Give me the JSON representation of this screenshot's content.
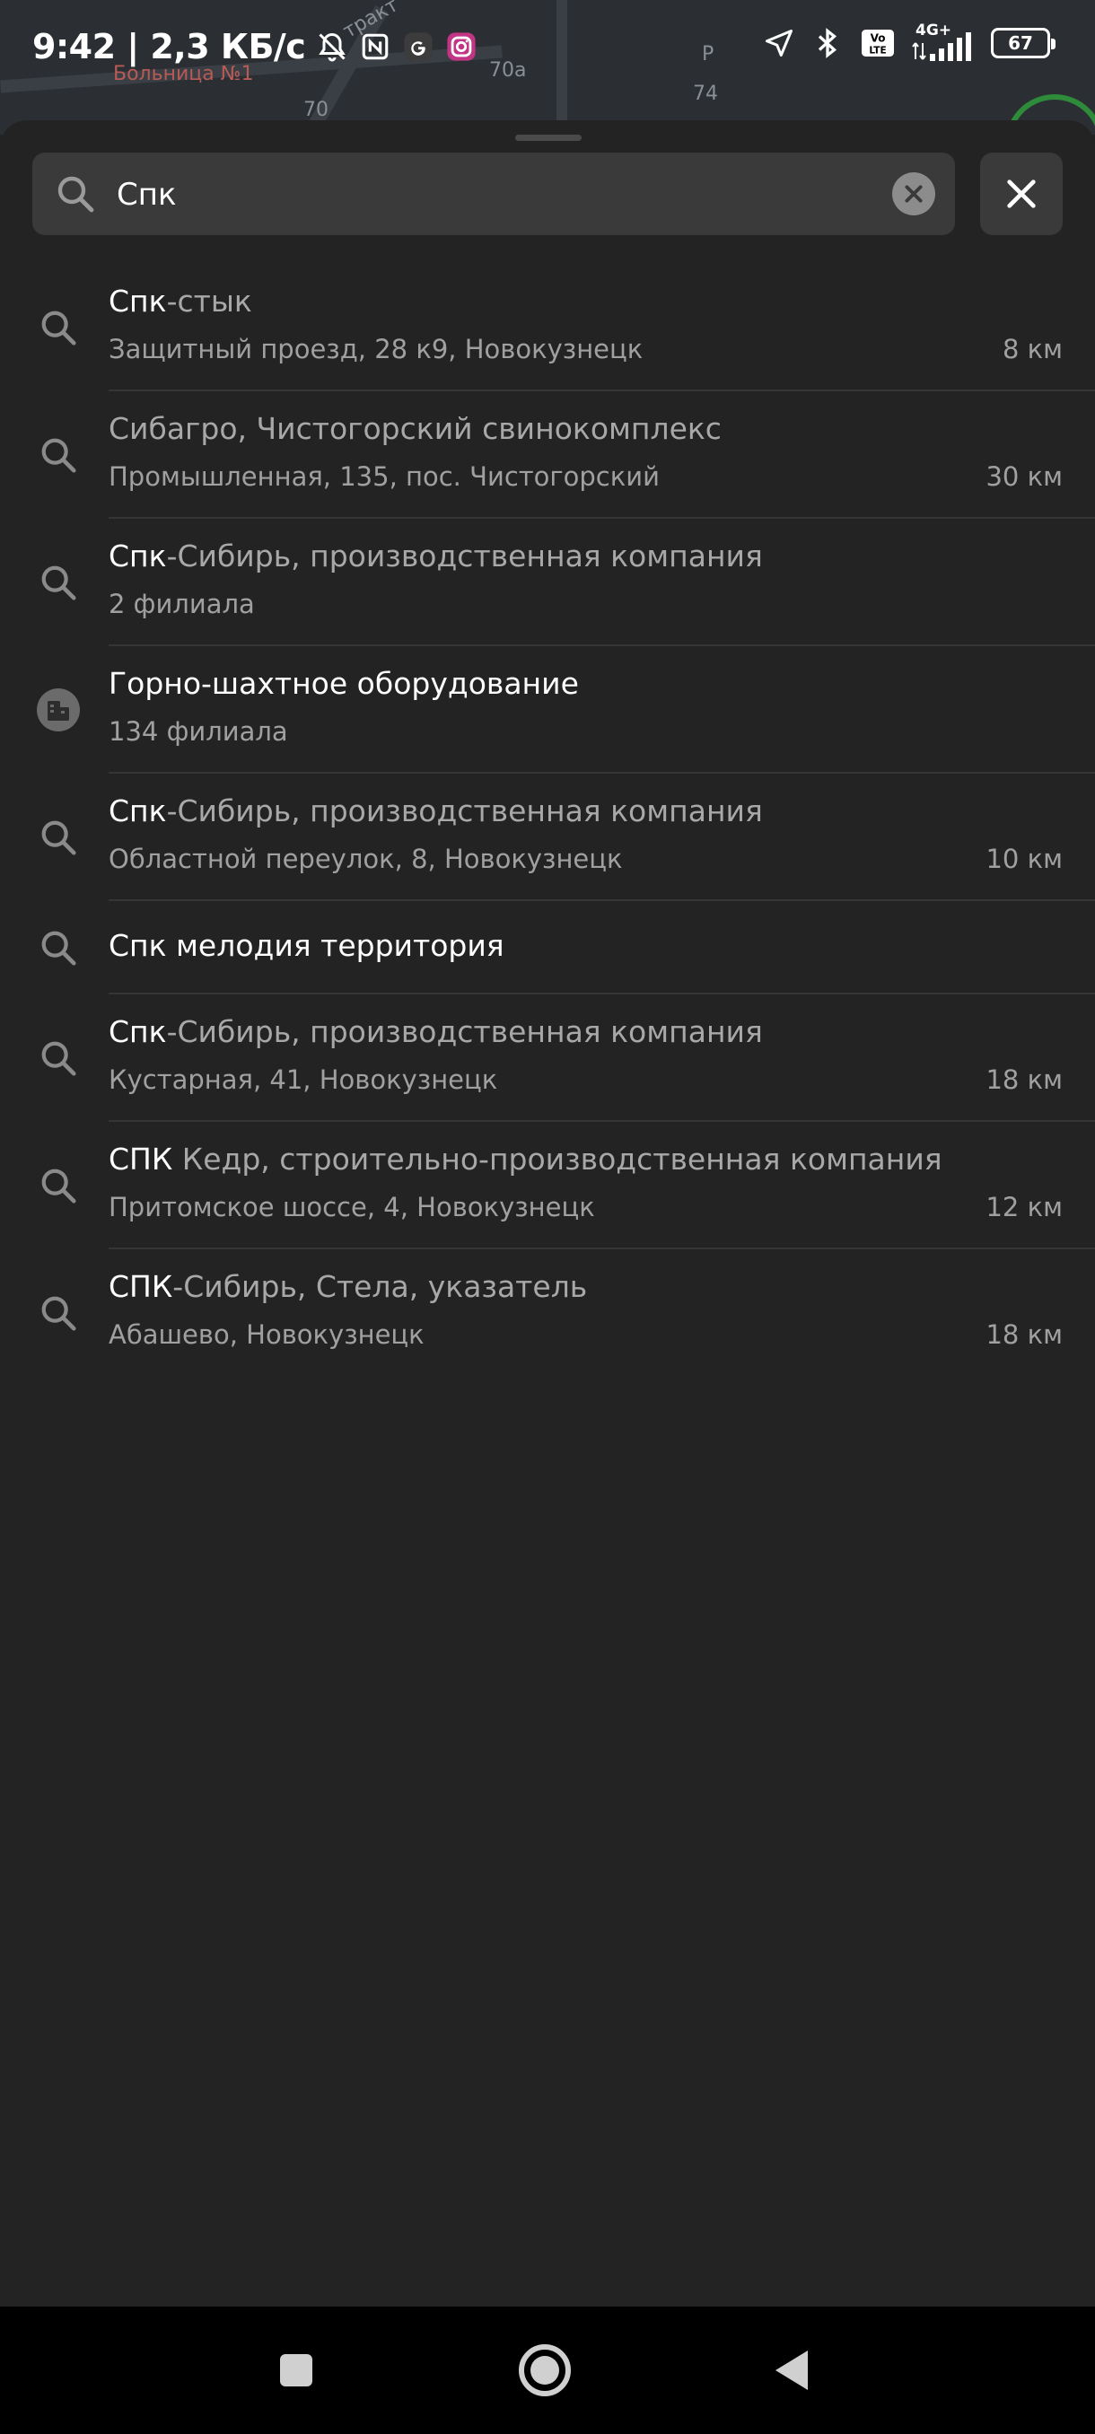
{
  "map": {
    "labels": [
      "Больница №1",
      "70а",
      "70",
      "74",
      "тракт",
      "Р"
    ]
  },
  "status_bar": {
    "time_speed": "9:42 | 2,3 КБ/с",
    "network": "4G+",
    "volte": "Vo LTE",
    "battery": "67"
  },
  "search": {
    "query": "Спк"
  },
  "results": [
    {
      "highlight": "Спк",
      "rest": "-стык",
      "subtitle": "Защитный проезд, 28 к9, Новокузнецк",
      "distance": "8 км",
      "icon": "search-icon"
    },
    {
      "highlight": "",
      "rest": "Сибагро, Чистогорский свинокомплекс",
      "subtitle": "Промышленная, 135, пос. Чистогорский",
      "distance": "30 км",
      "icon": "search-icon"
    },
    {
      "highlight": "Спк",
      "rest": "-Сибирь, производственная компания",
      "subtitle": "2 филиала",
      "distance": "",
      "icon": "search-icon"
    },
    {
      "highlight": "Горно-шахтное оборудование",
      "rest": "",
      "subtitle": "134 филиала",
      "distance": "",
      "icon": "category-icon"
    },
    {
      "highlight": "Спк",
      "rest": "-Сибирь, производственная компания",
      "subtitle": "Областной переулок, 8, Новокузнецк",
      "distance": "10 км",
      "icon": "search-icon"
    },
    {
      "highlight": "Спк мелодия территория",
      "rest": "",
      "subtitle": "",
      "distance": "",
      "icon": "search-icon"
    },
    {
      "highlight": "Спк",
      "rest": "-Сибирь, производственная компания",
      "subtitle": "Кустарная, 41, Новокузнецк",
      "distance": "18 км",
      "icon": "search-icon"
    },
    {
      "highlight": "СПК",
      "rest": " Кедр, строительно-производственная компания",
      "subtitle": "Притомское шоссе, 4, Новокузнецк",
      "distance": "12 км",
      "icon": "search-icon"
    },
    {
      "highlight": "СПК",
      "rest": "-Сибирь, Стела, указатель",
      "subtitle": "Абашево, Новокузнецк",
      "distance": "18 км",
      "icon": "search-icon"
    }
  ],
  "colors": {
    "background": "#232323",
    "field": "#3a3a3a",
    "secondary_text": "#a0a0a0",
    "divider": "#353535"
  }
}
